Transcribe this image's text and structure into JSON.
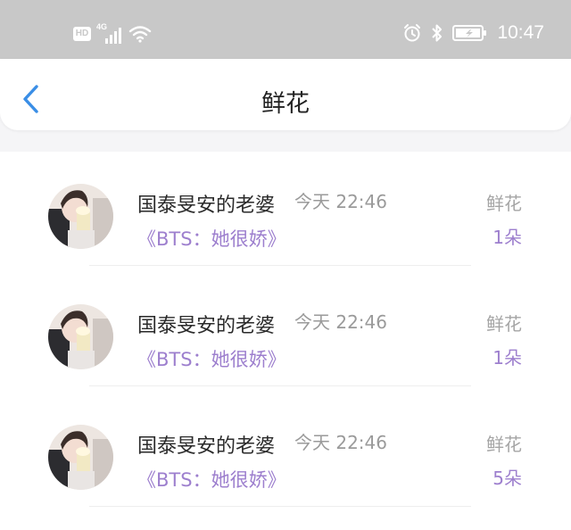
{
  "status_bar": {
    "hd_label": "HD",
    "network_label": "4G",
    "time": "10:47",
    "icons": [
      "hd-icon",
      "signal-icon",
      "wifi-icon",
      "alarm-icon",
      "bluetooth-icon",
      "battery-charging-icon"
    ]
  },
  "header": {
    "title": "鲜花",
    "back_icon": "chevron-left-icon"
  },
  "records": [
    {
      "user": "国泰旻安的老婆",
      "time": "今天 22:46",
      "work": "《BTS：她很娇》",
      "type": "鲜花",
      "count": "1朵"
    },
    {
      "user": "国泰旻安的老婆",
      "time": "今天 22:46",
      "work": "《BTS：她很娇》",
      "type": "鲜花",
      "count": "1朵"
    },
    {
      "user": "国泰旻安的老婆",
      "time": "今天 22:46",
      "work": "《BTS：她很娇》",
      "type": "鲜花",
      "count": "5朵"
    }
  ],
  "colors": {
    "accent_purple": "#9d7fce",
    "back_blue": "#3a8ee6",
    "status_bar_bg": "#c8c8c8"
  }
}
